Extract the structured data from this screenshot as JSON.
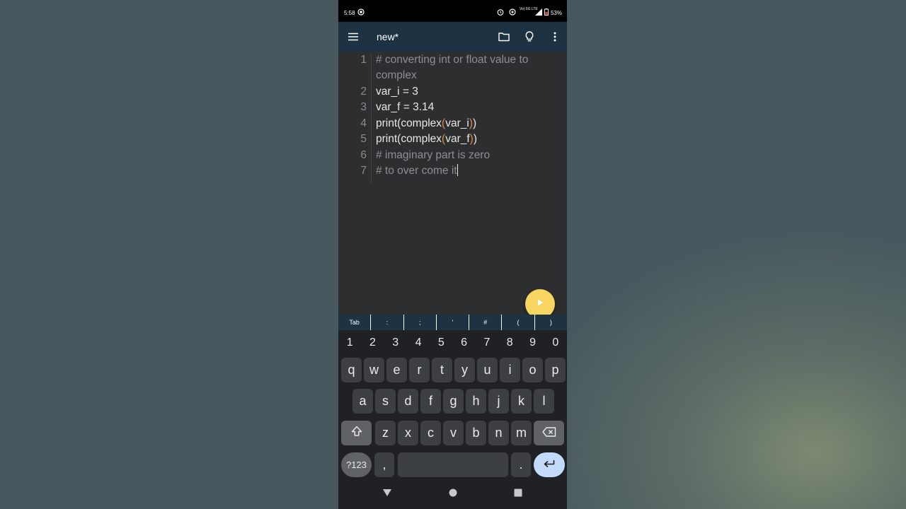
{
  "status_bar": {
    "time": "5:58",
    "network": "Vo) 5G LTE",
    "battery": "53%"
  },
  "app": {
    "title": "new*"
  },
  "editor": {
    "lines": [
      {
        "number": "1",
        "text": "# converting int or float value to complex"
      },
      {
        "number": "2",
        "text": "var_i = 3"
      },
      {
        "number": "3",
        "text": "var_f = 3.14"
      },
      {
        "number": "4",
        "text": "print(complex(var_i))"
      },
      {
        "number": "5",
        "text": "print(complex(var_f))"
      },
      {
        "number": "6",
        "text": "# imaginary part is zero"
      },
      {
        "number": "7",
        "text": "# to over come it"
      }
    ],
    "line4": {
      "a": "print(complex",
      "b": "(",
      "c": "var_i",
      "d": ")",
      "e": ")"
    },
    "line5": {
      "a": "print(complex",
      "b": "(",
      "c": "var_f",
      "d": ")",
      "e": ")"
    }
  },
  "symbol_bar": [
    "Tab",
    ":",
    ";",
    "'",
    "#",
    "(",
    ")"
  ],
  "keyboard": {
    "numbers": [
      "1",
      "2",
      "3",
      "4",
      "5",
      "6",
      "7",
      "8",
      "9",
      "0"
    ],
    "row1": [
      "q",
      "w",
      "e",
      "r",
      "t",
      "y",
      "u",
      "i",
      "o",
      "p"
    ],
    "row2": [
      "a",
      "s",
      "d",
      "f",
      "g",
      "h",
      "j",
      "k",
      "l"
    ],
    "row3": [
      "z",
      "x",
      "c",
      "v",
      "b",
      "n",
      "m"
    ],
    "symbols_key": "?123",
    "comma_key": ",",
    "period_key": "."
  },
  "colors": {
    "toolbar": "#1d3243",
    "editor_bg": "#2c2e30",
    "fab": "#f7d560",
    "paren": "#e08a3c",
    "enter_key": "#c2dbfb"
  },
  "icons": [
    "menu-icon",
    "folder-icon",
    "lightbulb-icon",
    "more-vert-icon",
    "play-icon",
    "shift-icon",
    "backspace-icon",
    "enter-icon",
    "nav-back-icon",
    "nav-home-icon",
    "nav-recents-icon"
  ]
}
